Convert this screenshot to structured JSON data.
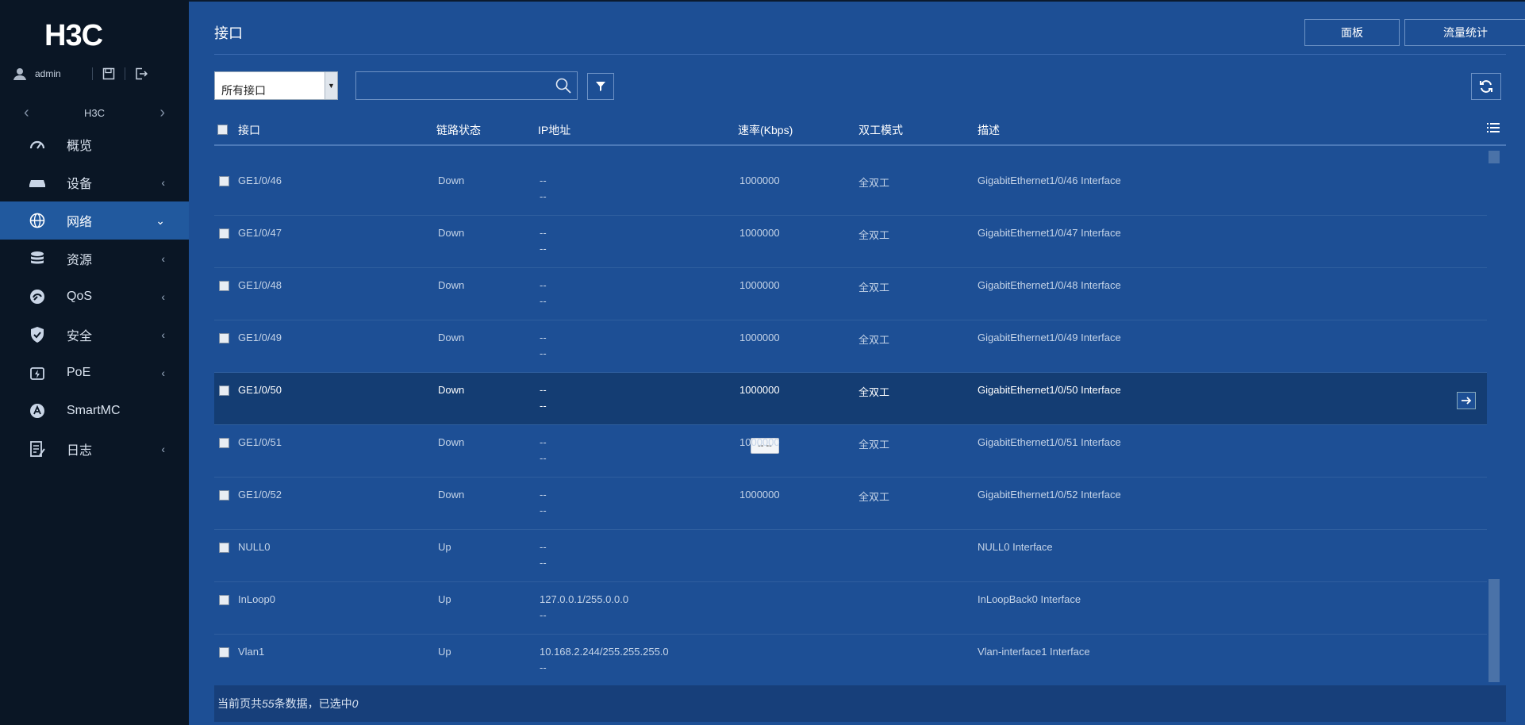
{
  "sidebar": {
    "logo_text": "H3C",
    "username": "admin",
    "device_name": "H3C",
    "menu": [
      {
        "label": "概览",
        "icon": "gauge-icon",
        "has_chevron": false
      },
      {
        "label": "设备",
        "icon": "device-icon",
        "has_chevron": true
      },
      {
        "label": "网络",
        "icon": "globe-icon",
        "has_chevron": true,
        "active": true
      },
      {
        "label": "资源",
        "icon": "database-icon",
        "has_chevron": true
      },
      {
        "label": "QoS",
        "icon": "qos-icon",
        "has_chevron": true
      },
      {
        "label": "安全",
        "icon": "shield-icon",
        "has_chevron": true
      },
      {
        "label": "PoE",
        "icon": "poe-icon",
        "has_chevron": true
      },
      {
        "label": "SmartMC",
        "icon": "smartmc-icon",
        "has_chevron": false
      },
      {
        "label": "日志",
        "icon": "log-icon",
        "has_chevron": true
      }
    ]
  },
  "header": {
    "title": "接口",
    "btn_panel": "面板",
    "btn_traffic": "流量统计"
  },
  "toolbar": {
    "filter_select_value": "所有接口",
    "search_value": ""
  },
  "table": {
    "columns": [
      "接口",
      "链路状态",
      "IP地址",
      "速率(Kbps)",
      "双工模式",
      "描述"
    ],
    "rows": [
      {
        "iface": "GE1/0/46",
        "status": "Down",
        "ip1": "--",
        "ip2": "--",
        "speed": "1000000",
        "duplex": "全双工",
        "desc": "GigabitEthernet1/0/46 Interface"
      },
      {
        "iface": "GE1/0/47",
        "status": "Down",
        "ip1": "--",
        "ip2": "--",
        "speed": "1000000",
        "duplex": "全双工",
        "desc": "GigabitEthernet1/0/47 Interface"
      },
      {
        "iface": "GE1/0/48",
        "status": "Down",
        "ip1": "--",
        "ip2": "--",
        "speed": "1000000",
        "duplex": "全双工",
        "desc": "GigabitEthernet1/0/48 Interface"
      },
      {
        "iface": "GE1/0/49",
        "status": "Down",
        "ip1": "--",
        "ip2": "--",
        "speed": "1000000",
        "duplex": "全双工",
        "desc": "GigabitEthernet1/0/49 Interface"
      },
      {
        "iface": "GE1/0/50",
        "status": "Down",
        "ip1": "--",
        "ip2": "--",
        "speed": "1000000",
        "duplex": "全双工",
        "desc": "GigabitEthernet1/0/50 Interface"
      },
      {
        "iface": "GE1/0/51",
        "status": "Down",
        "ip1": "--",
        "ip2": "--",
        "speed": "1000000",
        "duplex": "全双工",
        "desc": "GigabitEthernet1/0/51 Interface",
        "pill": "-- --"
      },
      {
        "iface": "GE1/0/52",
        "status": "Down",
        "ip1": "--",
        "ip2": "--",
        "speed": "1000000",
        "duplex": "全双工",
        "desc": "GigabitEthernet1/0/52 Interface"
      },
      {
        "iface": "NULL0",
        "status": "Up",
        "ip1": "--",
        "ip2": "--",
        "speed": "",
        "duplex": "",
        "desc": "NULL0 Interface"
      },
      {
        "iface": "InLoop0",
        "status": "Up",
        "ip1": "127.0.0.1/255.0.0.0",
        "ip2": "--",
        "speed": "",
        "duplex": "",
        "desc": "InLoopBack0 Interface"
      },
      {
        "iface": "Vlan1",
        "status": "Up",
        "ip1": "10.168.2.244/255.255.255.0",
        "ip2": "--",
        "speed": "",
        "duplex": "",
        "desc": "Vlan-interface1 Interface"
      }
    ]
  },
  "footer": {
    "prefix": "当前页共",
    "count": "55",
    "middle": "条数据，已选中",
    "selected": "0"
  },
  "colors": {
    "sidebar_bg": "#0a1625",
    "main_bg": "#1d4f95",
    "active_menu": "#21599e",
    "selected_row": "#143d73"
  }
}
